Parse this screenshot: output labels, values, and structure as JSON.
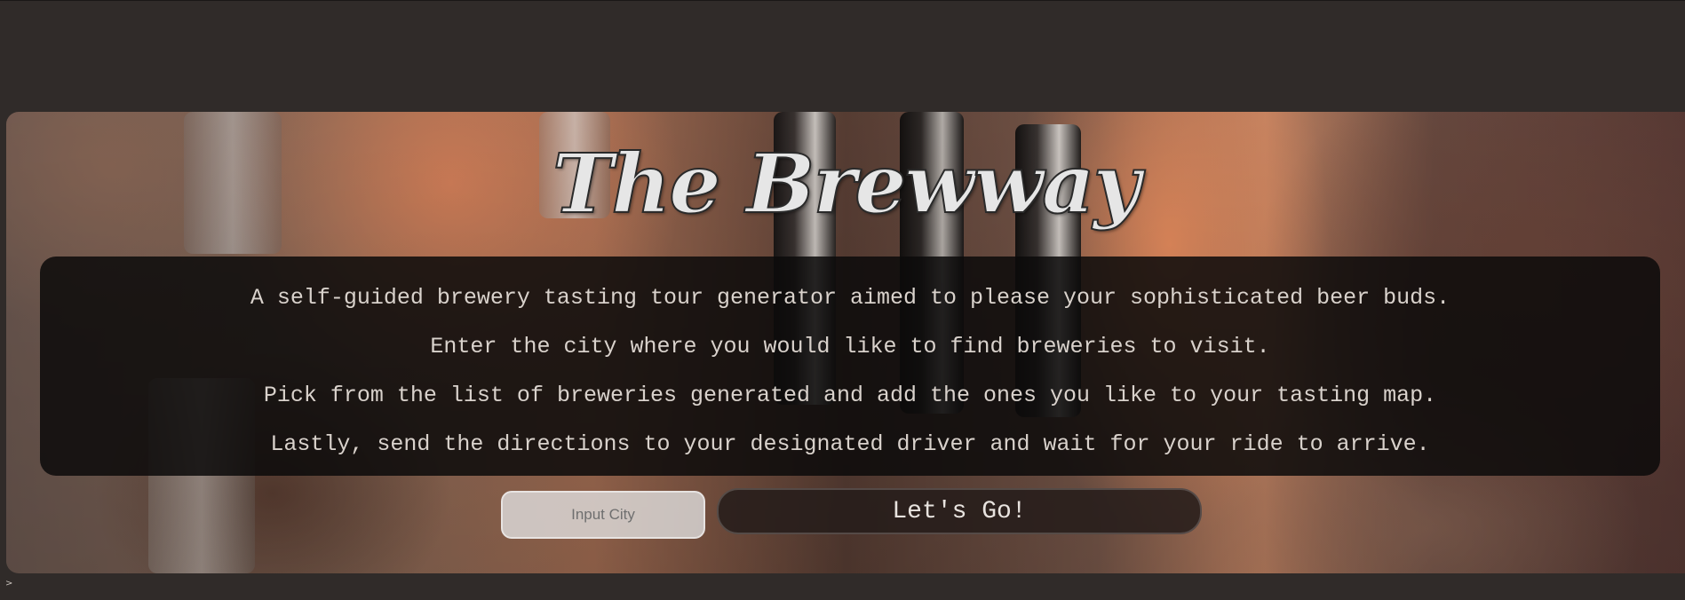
{
  "hero": {
    "title": "The Brewway"
  },
  "info": {
    "lines": [
      "A self-guided brewery tasting tour generator aimed to please your sophisticated beer buds.",
      "Enter the city where you would like to find breweries to visit.",
      "Pick from the list of breweries generated and add the ones you like to your tasting map.",
      "Lastly, send the directions to your designated driver and wait for your ride to arrive."
    ]
  },
  "search": {
    "placeholder": "Input City",
    "value": "",
    "button_label": "Let's Go!"
  },
  "footer": {
    "corner_mark": ">"
  },
  "colors": {
    "page_background": "#302b29",
    "panel_background": "#0c0a0a",
    "text": "#d9d2cc",
    "accent_orange": "#ec8f5f"
  }
}
